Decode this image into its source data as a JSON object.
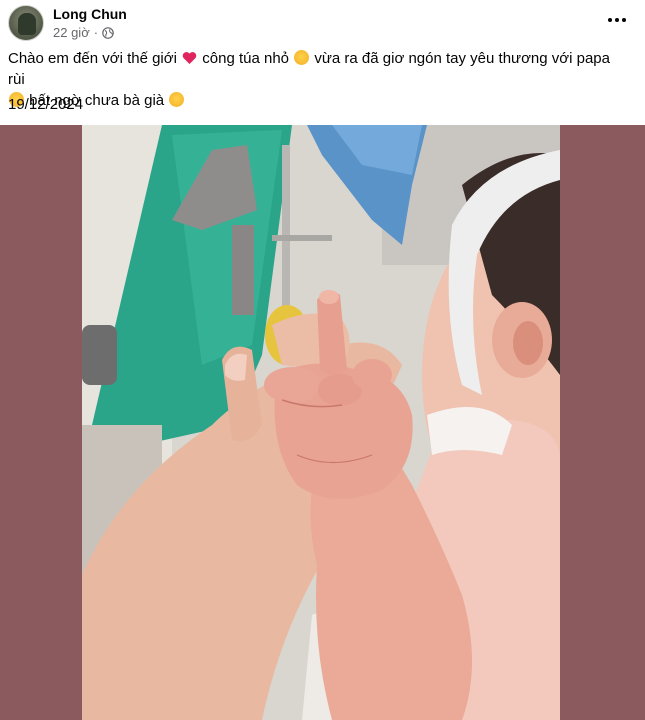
{
  "post": {
    "author": "Long Chun",
    "time": "22 giờ",
    "separator": "·",
    "privacy_icon": "globe-icon",
    "more_icon": "more-options-icon",
    "caption_part1": "Chào em đến với thế giới",
    "caption_part2": "công túa nhỏ",
    "caption_part3": "vừa ra đã giơ ngón tay yêu thương với papa rùi",
    "caption_part4": "bất ngờ chưa bà già",
    "date": "19/12/2024",
    "photo_description_icon": "photo-image"
  },
  "colors": {
    "frame_background": "#8a5a5f",
    "meta_text": "#65676b",
    "heart": "#e0245e"
  }
}
